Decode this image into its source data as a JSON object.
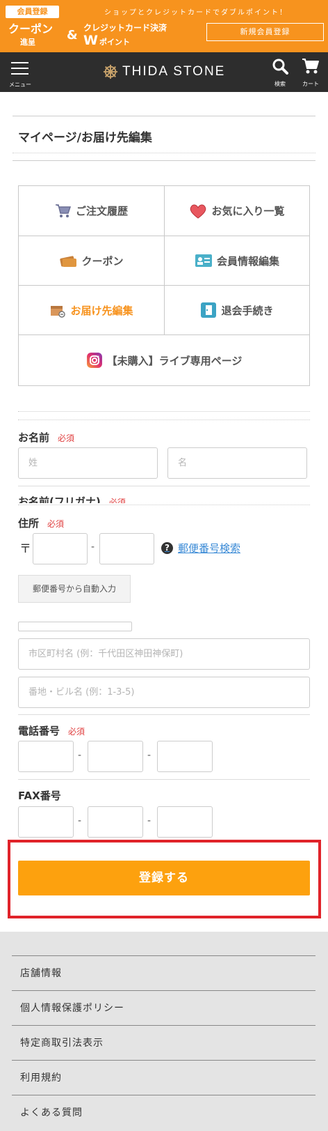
{
  "promo": {
    "badge": "会員登録",
    "tagline": "ショップとクレジットカードでダブルポイント！",
    "coupon": "クーポン",
    "coupon_sub": "進呈",
    "amp": "&",
    "credit": "クレジットカード決済",
    "w": "W",
    "point": "ポイント",
    "register": "新規会員登録",
    "color": "#f7931e"
  },
  "header": {
    "menu_label": "メニュー",
    "brand": "THIDA STONE",
    "search_label": "検索",
    "cart_label": "カート",
    "background": "#2d2d2d"
  },
  "page_title": "マイページ/お届け先編集",
  "menu": {
    "items": [
      {
        "label": "ご注文履歴",
        "icon": "cart-icon"
      },
      {
        "label": "お気に入り一覧",
        "icon": "heart-icon"
      },
      {
        "label": "クーポン",
        "icon": "coupon-icon"
      },
      {
        "label": "会員情報編集",
        "icon": "member-card-icon"
      },
      {
        "label": "お届け先編集",
        "icon": "delivery-box-icon",
        "active": true
      },
      {
        "label": "退会手続き",
        "icon": "exit-door-icon"
      },
      {
        "label": "【未購入】ライブ専用ページ",
        "icon": "instagram-icon"
      }
    ]
  },
  "form": {
    "name_label": "お名前",
    "required": "必須",
    "last_name_placeholder": "姓",
    "first_name_placeholder": "名",
    "kana_label": "お名前(フリガナ)",
    "address_label": "住所",
    "zip_mark": "〒",
    "zip_sep": "-",
    "zip_search": "郵便番号検索",
    "zip_search_icon": "question-icon",
    "autofill": "郵便番号から自動入力",
    "city_placeholder": "市区町村名 (例：千代田区神田神保町)",
    "street_placeholder": "番地・ビル名 (例：1-3-5)",
    "phone_label": "電話番号",
    "fax_label": "FAX番号",
    "sep": "-"
  },
  "submit_label": "登録する",
  "footer": {
    "links": [
      "店舗情報",
      "個人情報保護ポリシー",
      "特定商取引法表示",
      "利用規約",
      "よくある質問"
    ]
  }
}
